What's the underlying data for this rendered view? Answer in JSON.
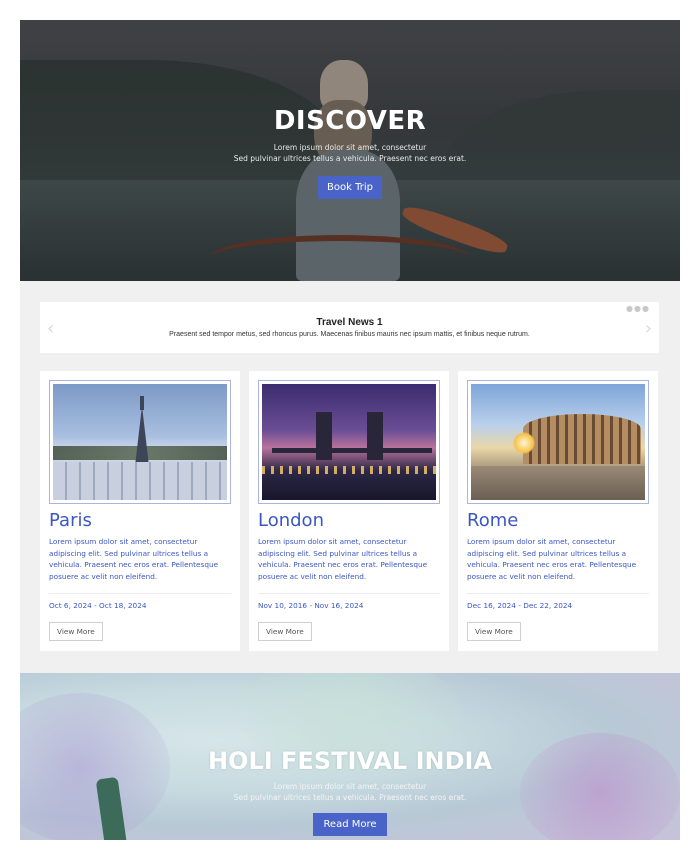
{
  "hero": {
    "title": "DISCOVER",
    "subtitle_line1": "Lorem ipsum dolor sit amet, consectetur",
    "subtitle_line2": "Sed pulvinar ultrices tellus a vehicula. Praesent nec eros erat.",
    "button_label": "Book Trip"
  },
  "news": {
    "title": "Travel News 1",
    "text": "Praesent sed tempor metus, sed rhoncus purus. Maecenas finibus mauris nec ipsum mattis, et finibus neque rutrum.",
    "icons": {
      "prev": "chevron-left-icon",
      "next": "chevron-right-icon"
    }
  },
  "cards": [
    {
      "title": "Paris",
      "description": "Lorem ipsum dolor sit amet, consectetur adipiscing elit. Sed pulvinar ultrices tellus a vehicula. Praesent nec eros erat. Pellentesque posuere ac velit non eleifend.",
      "dates": "Oct 6, 2024 - Oct 18, 2024",
      "button_label": "View More"
    },
    {
      "title": "London",
      "description": "Lorem ipsum dolor sit amet, consectetur adipiscing elit. Sed pulvinar ultrices tellus a vehicula. Praesent nec eros erat. Pellentesque posuere ac velit non eleifend.",
      "dates": "Nov 10, 2016 - Nov 16, 2024",
      "button_label": "View More"
    },
    {
      "title": "Rome",
      "description": "Lorem ipsum dolor sit amet, consectetur adipiscing elit. Sed pulvinar ultrices tellus a vehicula. Praesent nec eros erat. Pellentesque posuere ac velit non eleifend.",
      "dates": "Dec 16, 2024 - Dec 22, 2024",
      "button_label": "View More"
    }
  ],
  "holi": {
    "title": "HOLI FESTIVAL INDIA",
    "subtitle_line1": "Lorem ipsum dolor sit amet, consectetur",
    "subtitle_line2": "Sed pulvinar ultrices tellus a vehicula. Praesent nec eros erat.",
    "button_label": "Read More"
  },
  "colors": {
    "accent": "#4a63c9",
    "card_text": "#3b57c4",
    "background": "#f0f0f0"
  }
}
